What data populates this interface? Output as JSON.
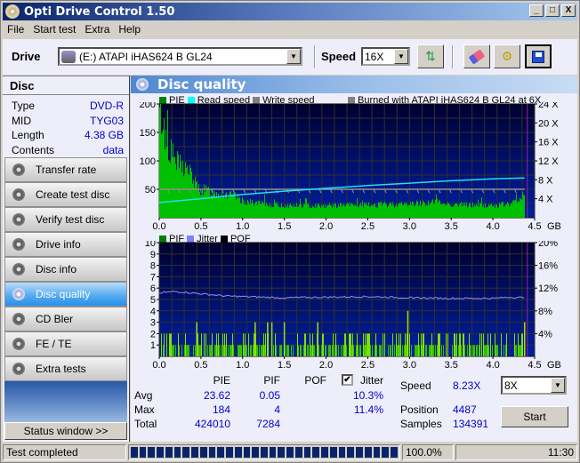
{
  "window": {
    "title": "Opti Drive Control 1.50",
    "buttons": [
      "_",
      "□",
      "X"
    ]
  },
  "menu": [
    "File",
    "Start test",
    "Extra",
    "Help"
  ],
  "toolbar": {
    "drive_label": "Drive",
    "drive_value": "(E:)  ATAPI iHAS624   B GL24",
    "speed_label": "Speed",
    "speed_value": "16X",
    "icons": [
      "refresh-icon",
      "eraser-icon",
      "settings-icon",
      "save-icon"
    ]
  },
  "disc": {
    "heading": "Disc",
    "rows": [
      {
        "label": "Type",
        "value": "DVD-R"
      },
      {
        "label": "MID",
        "value": "TYG03"
      },
      {
        "label": "Length",
        "value": "4.38 GB"
      },
      {
        "label": "Contents",
        "value": "data"
      }
    ]
  },
  "nav": {
    "items": [
      {
        "label": "Transfer rate",
        "active": false
      },
      {
        "label": "Create test disc",
        "active": false
      },
      {
        "label": "Verify test disc",
        "active": false
      },
      {
        "label": "Drive info",
        "active": false
      },
      {
        "label": "Disc info",
        "active": false
      },
      {
        "label": "Disc quality",
        "active": true
      },
      {
        "label": "CD Bler",
        "active": false
      },
      {
        "label": "FE / TE",
        "active": false
      },
      {
        "label": "Extra tests",
        "active": false
      }
    ],
    "status_window_button": "Status window >>"
  },
  "section": {
    "title": "Disc quality"
  },
  "chart_data": [
    {
      "type": "area",
      "title": "PIE / Read speed",
      "legend": [
        {
          "name": "PIE",
          "color": "#008000"
        },
        {
          "name": "Read speed",
          "color": "#00ffff"
        },
        {
          "name": "Write speed",
          "color": "#808080"
        },
        {
          "name": "Burned with ATAPI iHAS624   B GL24 at 6X",
          "color": "#808080"
        }
      ],
      "xlabel": "GB",
      "x_ticks": [
        "0.0",
        "0.5",
        "1.0",
        "1.5",
        "2.0",
        "2.5",
        "3.0",
        "3.5",
        "4.0",
        "4.5"
      ],
      "xlim": [
        0,
        4.5
      ],
      "y_ticks_left": [
        "50",
        "100",
        "150",
        "200"
      ],
      "ylim_left": [
        0,
        200
      ],
      "y_ticks_right": [
        "4 X",
        "8 X",
        "12 X",
        "16 X",
        "20 X",
        "24 X"
      ],
      "ylim_right": [
        0,
        24
      ],
      "grid": true,
      "series": [
        {
          "name": "PIE",
          "x": [
            0.0,
            0.02,
            0.05,
            0.1,
            0.15,
            0.2,
            0.25,
            0.3,
            0.35,
            0.4,
            0.45,
            0.5,
            0.6,
            0.7,
            0.8,
            0.9,
            1.0,
            1.2,
            1.5,
            2.0,
            2.5,
            3.0,
            3.3,
            3.5,
            4.0,
            4.2,
            4.3,
            4.35,
            4.38
          ],
          "values": [
            180,
            184,
            160,
            130,
            115,
            100,
            95,
            90,
            85,
            70,
            55,
            50,
            48,
            45,
            42,
            38,
            30,
            25,
            22,
            22,
            23,
            25,
            28,
            24,
            22,
            25,
            30,
            40,
            38
          ]
        },
        {
          "name": "Read speed",
          "x": [
            0.0,
            0.5,
            1.0,
            1.5,
            2.0,
            2.5,
            3.0,
            3.5,
            4.0,
            4.38
          ],
          "values": [
            3.2,
            4.0,
            4.9,
            5.6,
            6.2,
            6.8,
            7.3,
            7.8,
            8.2,
            8.4
          ]
        },
        {
          "name": "Write speed",
          "x": [
            0.0,
            4.38
          ],
          "values": [
            6,
            6
          ]
        }
      ]
    },
    {
      "type": "bar",
      "title": "PIF / Jitter",
      "legend": [
        {
          "name": "PIF",
          "color": "#008000"
        },
        {
          "name": "Jitter",
          "color": "#8080ff"
        },
        {
          "name": "POF",
          "color": "#000000"
        }
      ],
      "xlabel": "GB",
      "x_ticks": [
        "0.0",
        "0.5",
        "1.0",
        "1.5",
        "2.0",
        "2.5",
        "3.0",
        "3.5",
        "4.0",
        "4.5"
      ],
      "xlim": [
        0,
        4.5
      ],
      "y_ticks_left": [
        "1",
        "2",
        "3",
        "4",
        "5",
        "6",
        "7",
        "8",
        "9",
        "10"
      ],
      "ylim_left": [
        0,
        10
      ],
      "y_ticks_right": [
        "4%",
        "8%",
        "12%",
        "16%",
        "20%"
      ],
      "ylim_right": [
        0,
        20
      ],
      "grid": true,
      "series": [
        {
          "name": "PIF",
          "x": [
            0.45,
            1.15,
            1.3,
            1.35,
            1.5,
            1.9,
            2.98,
            4.38
          ],
          "values": [
            3,
            3,
            3,
            3,
            3,
            3,
            4,
            3
          ]
        },
        {
          "name": "Jitter",
          "x": [
            0.0,
            0.2,
            0.5,
            0.8,
            1.0,
            1.5,
            2.0,
            2.5,
            3.0,
            3.5,
            4.0,
            4.2,
            4.38
          ],
          "values": [
            11.2,
            11.4,
            11.0,
            10.6,
            10.5,
            10.3,
            10.4,
            10.5,
            10.3,
            10.2,
            10.2,
            10.4,
            10.3
          ]
        }
      ]
    }
  ],
  "stats": {
    "headers": [
      "PIE",
      "PIF",
      "POF",
      "Jitter"
    ],
    "jitter_checked": true,
    "rows": [
      {
        "label": "Avg",
        "pie": "23.62",
        "pif": "0.05",
        "jitter": "10.3%"
      },
      {
        "label": "Max",
        "pie": "184",
        "pif": "4",
        "jitter": "11.4%"
      },
      {
        "label": "Total",
        "pie": "424010",
        "pif": "7284",
        "jitter": ""
      }
    ],
    "speed_label": "Speed",
    "speed_value": "8.23X",
    "speed_select": "8X",
    "position_label": "Position",
    "position_value": "4487",
    "samples_label": "Samples",
    "samples_value": "134391",
    "start_button": "Start"
  },
  "statusbar": {
    "text": "Test completed",
    "progress_percent": 100,
    "progress_label": "100.0%",
    "time": "11:30"
  }
}
